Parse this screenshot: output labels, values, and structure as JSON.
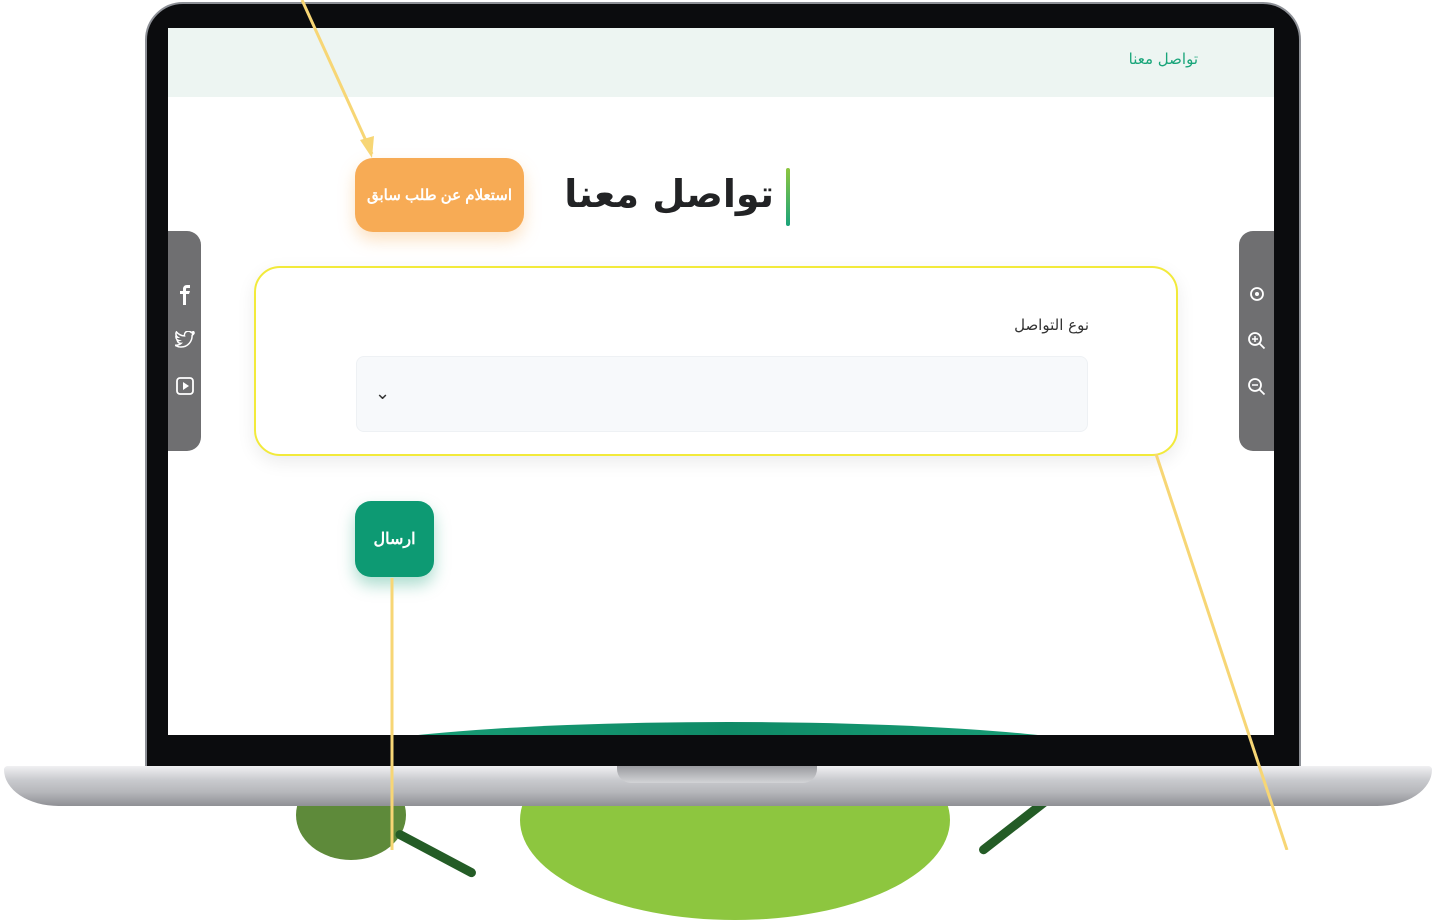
{
  "topbar": {
    "breadcrumb": "تواصل معنا"
  },
  "page": {
    "title": "تواصل معنا"
  },
  "buttons": {
    "previous_request": "استعلام عن طلب سابق",
    "send": "ارسال"
  },
  "form": {
    "contact_type_label": "نوع التواصل",
    "contact_type_value": ""
  },
  "icons": {
    "left_panel": [
      "facebook-icon",
      "twitter-icon",
      "youtube-icon"
    ],
    "right_panel": [
      "accessibility-icon",
      "zoom-in-icon",
      "zoom-out-icon"
    ],
    "select": "chevron-down-icon"
  },
  "colors": {
    "primary": "#0d9a73",
    "accent_orange": "#f7ab55",
    "annotation": "#f7d675",
    "highlight_border": "#f2ea3b",
    "topbar_bg": "#edf5f2"
  }
}
